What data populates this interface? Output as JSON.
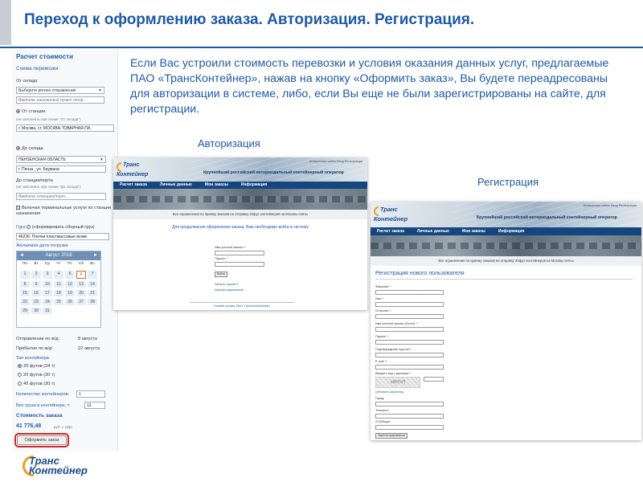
{
  "slide": {
    "title": "Переход к оформлению заказа. Авторизация. Регистрация.",
    "body_text": "Если Вас устроили стоимость перевозки и условия оказания данных услуг, предлагаемые ПАО «ТрансКонтейнер», нажав на кнопку «Оформить заказ», Вы будете переадресованы для авторизации в системе, либо, если Вы еще не были зарегистрированы на сайте, для регистрации.",
    "caption_auth": "Авторизация",
    "caption_reg": "Регистрация",
    "brand_color": "#1f5aa6",
    "accent_color": "#f29a21"
  },
  "calc": {
    "title": "Расчет стоимости",
    "scheme_label": "Схема перевозки:",
    "from_warehouse_label": "От склада",
    "region_select": "Выберите регион отправления",
    "from_city_input": "Введите населенный пункт отпр...",
    "from_station_label": "От станции",
    "from_station_hint": "(не заполнять при схеме \"От склада\")",
    "from_station_value": "г. Москва, ст. МОСКВА-ТОВАРНАЯ-ПА",
    "to_warehouse_label": "До склада",
    "to_region_select": "ПЕНЗЕНСКАЯ ОБЛАСТЬ",
    "to_city_value": "г. Пенза , ул. Баумана",
    "to_station_label": "До станции/порта",
    "to_station_hint": "(не заполнять при схеме \"До склада\")",
    "to_station_input": "Введите станцию/порт...",
    "terminal_services": "Включая терминальные услуги по станции назначения",
    "cargo_label": "Груз",
    "cargo_option": "(сформировать сборный груз)",
    "cargo_value": "46226: Плитки пластмассовые всяки",
    "date_label": "Желаемая дата погрузки",
    "calendar_month": "Август 2016",
    "calendar_prev": "◄",
    "calendar_next": "►",
    "calendar_days": [
      "Пн",
      "Вт",
      "Ср",
      "Чт",
      "Пт",
      "Сб",
      "Вс"
    ],
    "calendar_dates": [
      "",
      "",
      "",
      "",
      "",
      "",
      "",
      "1",
      "2",
      "3",
      "4",
      "5",
      "6",
      "7",
      "8",
      "9",
      "10",
      "11",
      "12",
      "13",
      "14",
      "15",
      "16",
      "17",
      "18",
      "19",
      "20",
      "21",
      "22",
      "23",
      "24",
      "25",
      "26",
      "27",
      "28",
      "29",
      "30",
      "31",
      "",
      "",
      "",
      ""
    ],
    "calendar_selected": "6",
    "departure_label": "Отправление по ж/д:",
    "departure_value": "8 августа",
    "arrival_label": "Прибытие по ж/д:",
    "arrival_value": "22 августа",
    "container_type_label": "Тип контейнера:",
    "container_options": [
      "20 футов (24 т)",
      "20 футов (30 т)",
      "40 футов (30 т)"
    ],
    "container_selected": 0,
    "containers_count_label": "Количество контейнеров:",
    "containers_count_value": "1",
    "cargo_weight_label": "Вес груза в контейнере, т:",
    "cargo_weight_value": "12",
    "cost_label": "Стоимость заказа",
    "cost_value": "41 776,48",
    "cost_unit": "руб. с НДС",
    "order_button": "Оформить заказ"
  },
  "site_auth": {
    "logo_line1": "Транс",
    "logo_line2": "Контейнер",
    "slogan": "Крупнейший российский интермодальный контейнерный оператор",
    "top_links": "Интересные сайты   Вход   Регистрация",
    "nav": [
      "Расчет заказа",
      "Личные данные",
      "Мои заказы",
      "Информация"
    ],
    "notice": "Все ограничения по приему заказов на отправку 20фут контейнеров на Москвы сняты",
    "message": "Для продолжения оформления заказа, Вам необходимо войти в систему",
    "login_label": "Имя учетной записи *:",
    "password_label": "Пароль *:",
    "login_button": "Войти",
    "forgot_link": "Забыли пароль?",
    "register_link": "Зарегистрироваться",
    "footer": "Онлайн-сервис ПАО «ТрансКонтейнер»"
  },
  "site_reg": {
    "logo_line1": "Транс",
    "logo_line2": "Контейнер",
    "slogan": "Крупнейший российский интермодальный контейнерный оператор",
    "top_links": "Интересные сайты   Вход   Регистрация",
    "nav": [
      "Расчет заказа",
      "Личные данные",
      "Мои заказы",
      "Информация"
    ],
    "notice": "Все ограничения по приему заказов на отправку 20фут контейнеров на Москвы сняты",
    "title": "Регистрация нового пользователя",
    "fields": [
      "Фамилия *:",
      "Имя *:",
      "Отчество *:",
      "Имя учетной записи (Логин) *:",
      "Пароль *:",
      "Подтверждение пароля *:",
      "E-mail *:",
      "Введите код с картинки *:"
    ],
    "captcha_text": "сКРУпП",
    "captcha_refresh": "(обновить картинку)",
    "extra_fields": [
      "Город:",
      "Телефон:",
      "ICQ/Skype:"
    ],
    "submit_button": "Зарегистрироваться"
  },
  "footer_logo": {
    "line1": "Транс",
    "line2": "Контейнер"
  }
}
